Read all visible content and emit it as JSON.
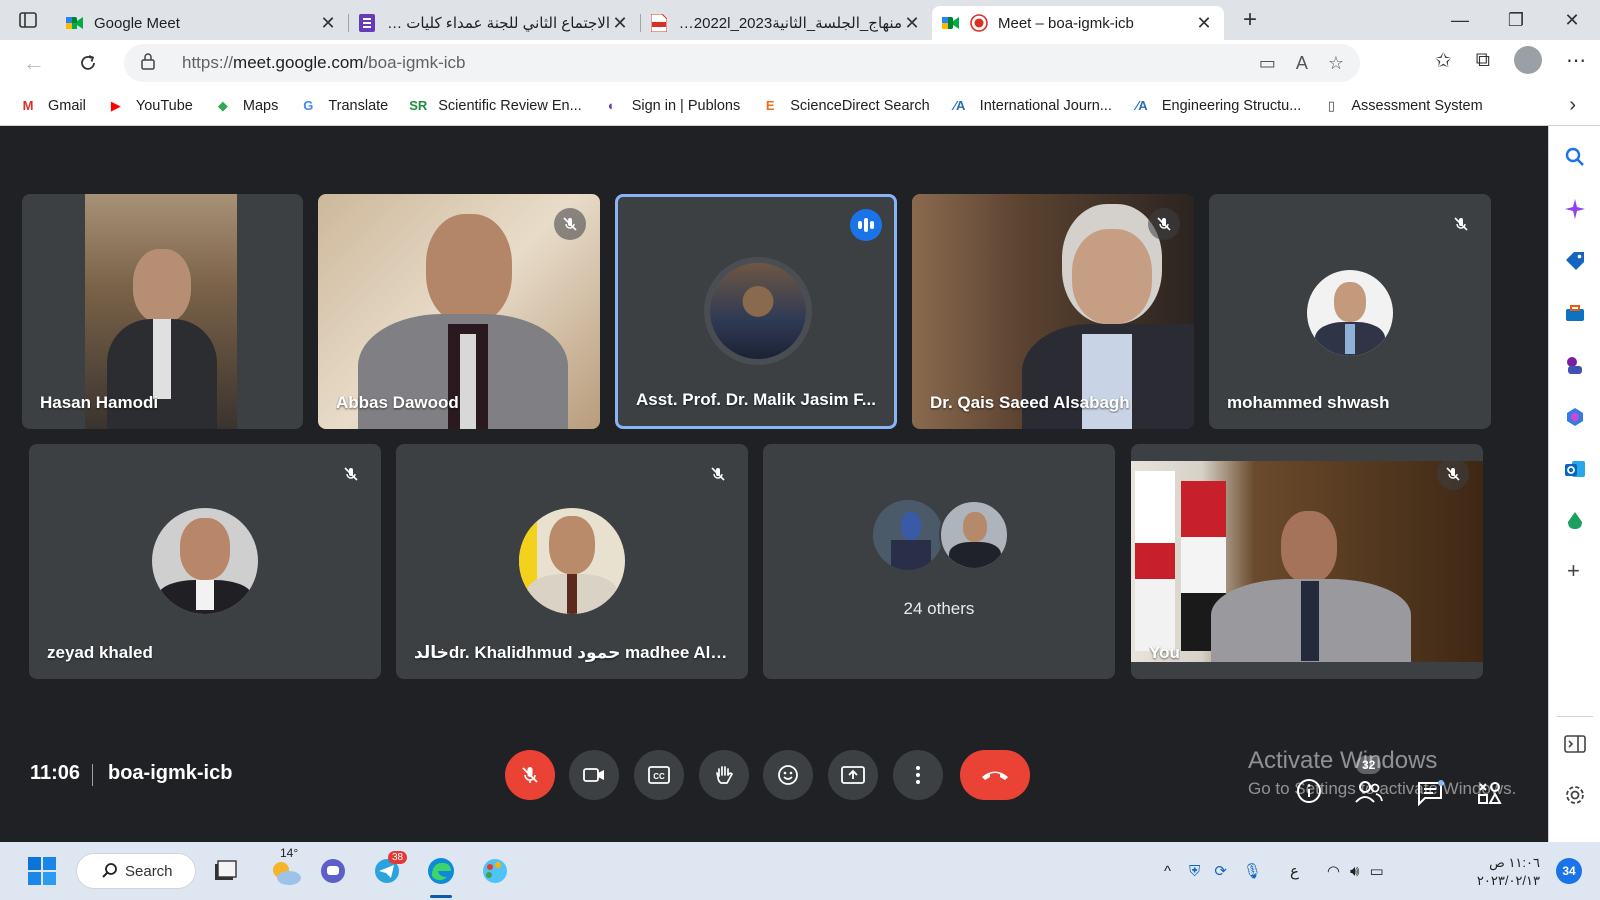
{
  "browser": {
    "tabs": [
      {
        "title": "Google Meet",
        "favicon": "meet-icon",
        "active": false
      },
      {
        "title": "الاجتماع الثاني للجنة عمداء كليات الز",
        "favicon": "forms-icon",
        "active": false
      },
      {
        "title": "منهاج_الجلسة_الثانية2023_2022l_ال",
        "favicon": "pdf-icon",
        "active": false
      },
      {
        "title": "Meet – boa-igmk-icb",
        "favicon": "meet-icon",
        "active": true
      }
    ],
    "url_prefix": "https://",
    "url_host": "meet.google.com",
    "url_path": "/boa-igmk-icb",
    "favorites": [
      {
        "label": "Gmail",
        "icon": "gmail-icon",
        "icon_text": "M",
        "icon_color": "#d93025"
      },
      {
        "label": "YouTube",
        "icon": "youtube-icon",
        "icon_text": "▶",
        "icon_color": "#ff0000"
      },
      {
        "label": "Maps",
        "icon": "maps-icon",
        "icon_text": "◆",
        "icon_color": "#34a853"
      },
      {
        "label": "Translate",
        "icon": "translate-icon",
        "icon_text": "G",
        "icon_color": "#4285f4"
      },
      {
        "label": "Scientific Review En...",
        "icon": "sr-icon",
        "icon_text": "SR",
        "icon_color": "#1e8e3e"
      },
      {
        "label": "Sign in | Publons",
        "icon": "publons-icon",
        "icon_text": "◐",
        "icon_color": "#6a3ea1"
      },
      {
        "label": "ScienceDirect Search",
        "icon": "elsevier-icon",
        "icon_text": "E",
        "icon_color": "#e9711c"
      },
      {
        "label": "International Journ...",
        "icon": "journal-icon",
        "icon_text": "⁄A",
        "icon_color": "#2a6fb0"
      },
      {
        "label": "Engineering Structu...",
        "icon": "journal-icon",
        "icon_text": "⁄A",
        "icon_color": "#2a6fb0"
      },
      {
        "label": "Assessment System",
        "icon": "document-icon",
        "icon_text": "▯",
        "icon_color": "#444444"
      }
    ]
  },
  "meet": {
    "participants_row1": [
      {
        "name": "Hasan Hamodi",
        "muted": false,
        "type": "video"
      },
      {
        "name": "Abbas Dawood",
        "muted": true,
        "type": "video"
      },
      {
        "name": "Asst. Prof. Dr. Malik Jasim F...",
        "muted": false,
        "speaking": true,
        "type": "avatar"
      },
      {
        "name": "Dr. Qais Saeed Alsabagh",
        "muted": true,
        "type": "video"
      },
      {
        "name": "mohammed shwash",
        "muted": true,
        "type": "avatar"
      }
    ],
    "participants_row2": [
      {
        "name": "zeyad khaled",
        "muted": true,
        "type": "avatar"
      },
      {
        "name": "خالدdr. Khalidhmud حمود madhee Aljan...",
        "muted": true,
        "type": "avatar"
      },
      {
        "name": "24 others",
        "type": "others"
      },
      {
        "name": "You",
        "muted": true,
        "type": "video"
      }
    ],
    "time": "11:06",
    "meeting_code": "boa-igmk-icb",
    "participant_count": "32",
    "colors": {
      "end_call": "#ea4335",
      "speaking_border": "#8ab4f8",
      "tile": "#3c4043",
      "background": "#202124"
    }
  },
  "activation": {
    "title": "Activate Windows",
    "subtitle": "Go to Settings to activate Windows."
  },
  "taskbar": {
    "search_label": "Search",
    "weather": "14°",
    "telegram_badge": "38",
    "ime": "ع",
    "clock_time": "١١:٠٦ ص",
    "clock_date": "٢٠٢٣/٠٢/١٣",
    "notifications": "34"
  }
}
